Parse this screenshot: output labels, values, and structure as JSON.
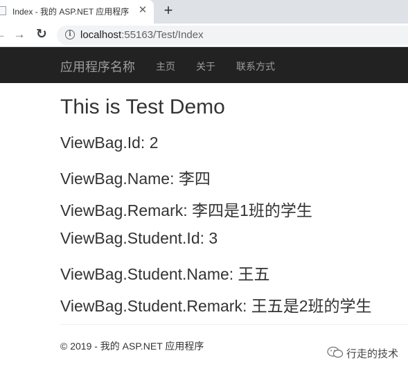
{
  "browser": {
    "tab_title": "Index - 我的 ASP.NET 应用程序",
    "tab_close": "✕",
    "new_tab": "+",
    "back": "←",
    "forward": "→",
    "reload": "↻",
    "info": "i",
    "url_host": "localhost",
    "url_rest": ":55163/Test/Index"
  },
  "nav": {
    "brand": "应用程序名称",
    "links": [
      "主页",
      "关于",
      "联系方式"
    ]
  },
  "main": {
    "heading": "This is Test Demo",
    "lines": [
      "ViewBag.Id: 2",
      "ViewBag.Name: 李四",
      "ViewBag.Remark: 李四是1班的学生",
      "ViewBag.Student.Id: 3",
      "ViewBag.Student.Name: 王五",
      "ViewBag.Student.Remark: 王五是2班的学生"
    ]
  },
  "footer": {
    "text": "© 2019 - 我的 ASP.NET 应用程序"
  },
  "watermark": {
    "text": "行走的技术"
  }
}
